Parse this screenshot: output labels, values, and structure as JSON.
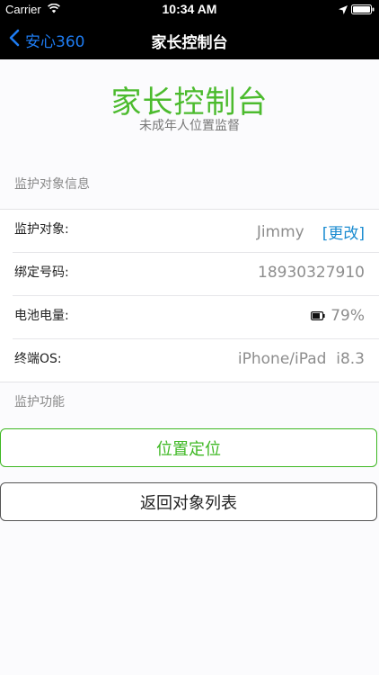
{
  "status_bar": {
    "carrier": "Carrier",
    "time": "10:34 AM",
    "icons": [
      "wifi-icon",
      "location-arrow-icon",
      "battery-icon"
    ]
  },
  "nav": {
    "back_label": "安心360",
    "title": "家长控制台"
  },
  "hero": {
    "title": "家长控制台",
    "subtitle": "未成年人位置监督"
  },
  "sections": {
    "info_label": "监护对象信息",
    "function_label": "监护功能"
  },
  "info_rows": {
    "target_label": "监护对象:",
    "target_name": "Jimmy",
    "change_link": "[更改]",
    "phone_label": "绑定号码:",
    "phone_value": "18930327910",
    "battery_label": "电池电量:",
    "battery_value": "79%",
    "os_label": "终端OS:",
    "os_value": "iPhone/iPad  i8.3"
  },
  "buttons": {
    "locate": "位置定位",
    "back_to_list": "返回对象列表"
  },
  "colors": {
    "accent_green": "#4cbb2e",
    "link_blue": "#1a8bd0",
    "nav_back_blue": "#1e7cf2",
    "topbar_black": "#000000"
  }
}
